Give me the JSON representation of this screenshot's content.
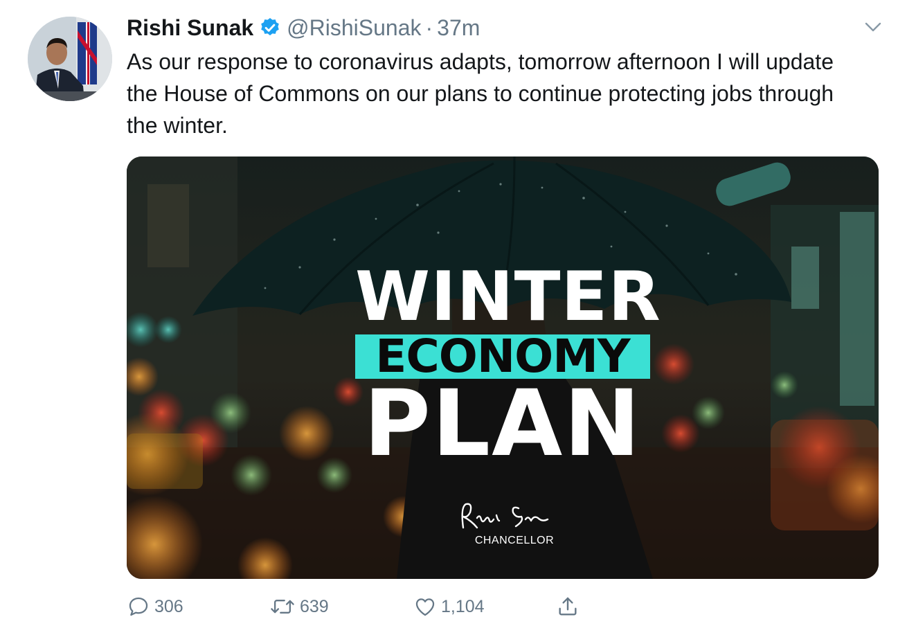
{
  "author": {
    "display_name": "Rishi Sunak",
    "handle": "@RishiSunak",
    "separator": "·",
    "time": "37m",
    "verified_icon": "verified-badge-icon"
  },
  "tweet": {
    "text": "As our response to coronavirus adapts, tomorrow afternoon I will update the House of Commons on our plans to continue protecting jobs through the winter."
  },
  "media": {
    "line1": "WINTER",
    "line2": "ECONOMY",
    "line3": "PLAN",
    "subtitle": "CHANCELLOR",
    "signature_text": "Rishi Sunak",
    "accent_color": "#3be0d4"
  },
  "actions": {
    "reply_count": "306",
    "retweet_count": "639",
    "like_count": "1,104"
  },
  "colors": {
    "text_primary": "#14171a",
    "text_secondary": "#657786",
    "verified": "#1da1f2"
  }
}
